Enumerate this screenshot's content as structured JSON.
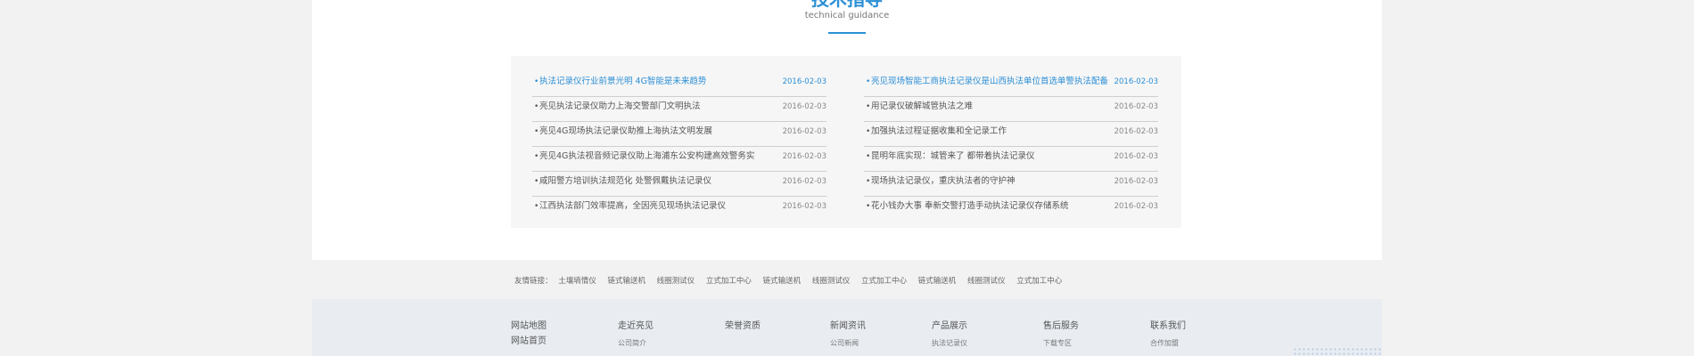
{
  "section": {
    "title": "技术指导",
    "subtitle": "technical guidance"
  },
  "news": {
    "left": [
      {
        "title": "执法记录仪行业前景光明 4G智能是未来趋势",
        "date": "2016-02-03",
        "active": true
      },
      {
        "title": "亮见执法记录仪助力上海交警部门文明执法",
        "date": "2016-02-03"
      },
      {
        "title": "亮见4G现场执法记录仪助推上海执法文明发展",
        "date": "2016-02-03"
      },
      {
        "title": "亮见4G执法视音频记录仪助上海浦东公安构建高效警务实",
        "date": "2016-02-03"
      },
      {
        "title": "咸阳警方培训执法规范化 处警佩戴执法记录仪",
        "date": "2016-02-03"
      },
      {
        "title": "江西执法部门效率提高，全因亮见现场执法记录仪",
        "date": "2016-02-03"
      }
    ],
    "right": [
      {
        "title": "亮见现场智能工商执法记录仪是山西执法单位首选单警执法配备",
        "date": "2016-02-03",
        "active": true
      },
      {
        "title": "用记录仪破解城管执法之难",
        "date": "2016-02-03"
      },
      {
        "title": "加强执法过程证据收集和全记录工作",
        "date": "2016-02-03"
      },
      {
        "title": "昆明年底实现：城管来了 都带着执法记录仪",
        "date": "2016-02-03"
      },
      {
        "title": "现场执法记录仪，重庆执法者的守护神",
        "date": "2016-02-03"
      },
      {
        "title": "花小钱办大事 奉新交警打造手动执法记录仪存储系统",
        "date": "2016-02-03"
      }
    ]
  },
  "friend_links": {
    "label": "友情链接：",
    "items": [
      "土壤墒情仪",
      "链式输送机",
      "线圈测试仪",
      "立式加工中心",
      "链式输送机",
      "线圈测试仪",
      "立式加工中心",
      "链式输送机",
      "线圈测试仪",
      "立式加工中心"
    ]
  },
  "footer": {
    "col1": {
      "head": "网站地图",
      "head2": "网站首页"
    },
    "col2": {
      "head": "走近亮见",
      "sub": "公司简介"
    },
    "col3": {
      "head": "荣誉资质"
    },
    "col4": {
      "head": "新闻资讯",
      "sub": "公司新闻"
    },
    "col5": {
      "head": "产品展示",
      "sub": "执法记录仪"
    },
    "col6": {
      "head": "售后服务",
      "sub": "下载专区"
    },
    "col7": {
      "head": "联系我们",
      "sub": "合作加盟"
    }
  },
  "colors": {
    "accent": "#2b8fd6",
    "footer_bg": "#e9edf2"
  }
}
